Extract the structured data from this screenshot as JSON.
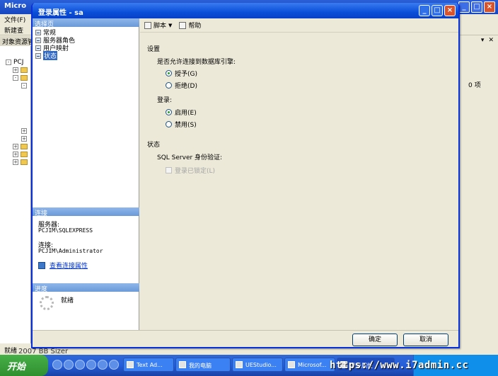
{
  "background_window": {
    "title": "Micro",
    "menu_file": "文件(F)",
    "toolbar_new": "新建查",
    "object_explorer_header": "对象资源管",
    "tree_root": "PCJ",
    "item_count": "0 项",
    "status": "就绪",
    "copyright": "2007 BB Sizer"
  },
  "dialog": {
    "title": "登录属性 - sa",
    "left_pane": {
      "select_page_header": "选择页",
      "pages": [
        "常规",
        "服务器角色",
        "用户映射",
        "状态"
      ],
      "selected_page_index": 3,
      "connection_header": "连接",
      "server_label": "服务器:",
      "server_value": "PCJIM\\SQLEXPRESS",
      "connection_label": "连接:",
      "connection_value": "PCJIM\\Administrator",
      "view_connection_link": "查看连接属性",
      "progress_header": "进度",
      "progress_status": "就绪"
    },
    "toolbar": {
      "script_label": "脚本",
      "help_label": "帮助"
    },
    "settings": {
      "group_label": "设置",
      "permission_question": "是否允许连接到数据库引擎:",
      "grant_label": "授予(G)",
      "deny_label": "拒绝(D)",
      "login_label": "登录:",
      "enabled_label": "启用(E)",
      "disabled_label": "禁用(S)",
      "permission_selected": "grant",
      "login_selected": "enabled"
    },
    "status": {
      "group_label": "状态",
      "sql_auth_label": "SQL Server 身份验证:",
      "locked_label": "登录已锁定(L)",
      "locked_checked": false
    },
    "buttons": {
      "ok": "确定",
      "cancel": "取消"
    }
  },
  "taskbar": {
    "start_label": "开始",
    "tasks": [
      "Text Ad...",
      "我的电脑",
      "UEStudio...",
      "Microsof...",
      "登录属性"
    ],
    "active_task_index": 4,
    "watermark": "https://www.i7admin.cc"
  }
}
